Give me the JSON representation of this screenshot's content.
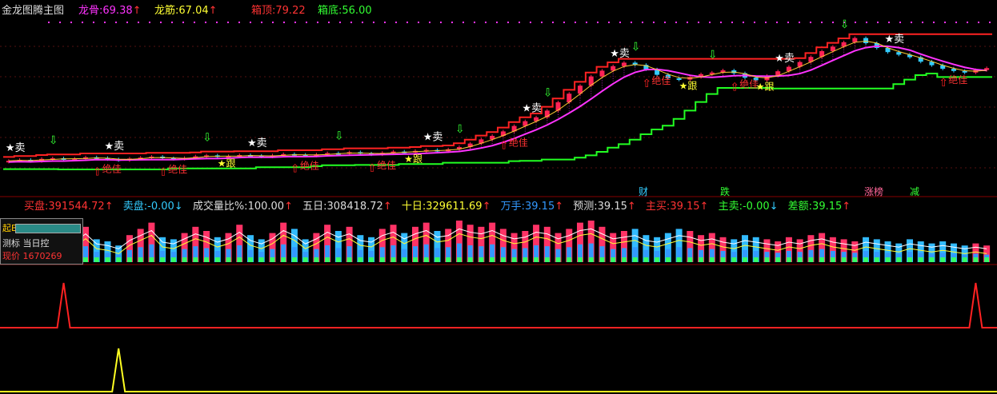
{
  "header": {
    "title": "金龙图腾主图",
    "items": [
      {
        "label": "龙骨:",
        "value": "69.38",
        "arrow": "↑",
        "color": "#ff33ff"
      },
      {
        "label": "龙筋:",
        "value": "67.04",
        "arrow": "↑",
        "color": "#ffff33"
      },
      {
        "label": "箱顶:",
        "value": "79.22",
        "arrow": "",
        "color": "#ff3333"
      },
      {
        "label": "箱底:",
        "value": "56.00",
        "arrow": "",
        "color": "#33ff33"
      }
    ]
  },
  "volume_header": {
    "items": [
      {
        "label": "买盘:",
        "value": "391544.72",
        "arrow": "↑",
        "color": "#ff3333"
      },
      {
        "label": "卖盘:",
        "value": "-0.00",
        "arrow": "↓",
        "color": "#33ccff"
      },
      {
        "label": "成交量比%:",
        "value": "100.00",
        "arrow": "↑",
        "color": "#dddddd"
      },
      {
        "label": "五日:",
        "value": "308418.72",
        "arrow": "↑",
        "color": "#dddddd"
      },
      {
        "label": "十日:",
        "value": "329611.69",
        "arrow": "↑",
        "color": "#ffff33"
      },
      {
        "label": "万手:",
        "value": "39.15",
        "arrow": "↑",
        "color": "#3399ff"
      },
      {
        "label": "预测:",
        "value": "39.15",
        "arrow": "↑",
        "color": "#dddddd"
      },
      {
        "label": "主买:",
        "value": "39.15",
        "arrow": "↑",
        "color": "#ff3333"
      },
      {
        "label": "主卖:",
        "value": "-0.00",
        "arrow": "↓",
        "color": "#33ff33"
      },
      {
        "label": "差额:",
        "value": "39.15",
        "arrow": "↑",
        "color": "#33ff33"
      }
    ]
  },
  "event_labels": [
    {
      "text": "财",
      "color": "#33ccff"
    },
    {
      "text": "跌",
      "color": "#33ff33"
    },
    {
      "text": "涨榜",
      "color": "#ff6699"
    },
    {
      "text": "减",
      "color": "#33ff33"
    }
  ],
  "signal_labels": {
    "sell": "卖",
    "buy": "绝佳",
    "follow": "跟"
  },
  "info_box": {
    "line1": "起B",
    "line2": "测标 当日控",
    "line3": "现价 1670269"
  },
  "chart_data": {
    "type": "candlestick",
    "title": "金龙图腾主图",
    "series": [
      {
        "name": "龙骨",
        "color": "#ff33ff",
        "last": 69.38
      },
      {
        "name": "龙筋",
        "color": "#ffff33",
        "last": 67.04
      },
      {
        "name": "箱顶",
        "color": "#ff3333",
        "last": 79.22
      },
      {
        "name": "箱底",
        "color": "#33ff33",
        "last": 56.0
      }
    ],
    "closes": [
      45.2,
      45.5,
      45.1,
      45.8,
      46.0,
      45.6,
      45.9,
      46.3,
      46.1,
      45.7,
      45.4,
      45.9,
      46.2,
      46.5,
      46.0,
      45.8,
      46.1,
      46.6,
      46.9,
      46.4,
      46.7,
      47.0,
      46.8,
      46.5,
      46.9,
      47.3,
      47.1,
      46.8,
      47.2,
      47.6,
      47.4,
      47.9,
      47.5,
      47.2,
      47.7,
      48.1,
      47.8,
      48.3,
      48.6,
      48.2,
      48.8,
      49.5,
      50.6,
      51.9,
      53.0,
      54.4,
      56.1,
      57.6,
      58.8,
      60.9,
      63.5,
      66.2,
      68.7,
      71.6,
      73.4,
      74.8,
      75.9,
      75.2,
      73.8,
      72.1,
      71.0,
      70.6,
      71.4,
      72.3,
      72.8,
      73.5,
      72.6,
      71.2,
      70.4,
      71.8,
      73.2,
      74.6,
      76.1,
      77.7,
      79.5,
      80.9,
      82.3,
      83.6,
      82.0,
      80.5,
      79.2,
      78.4,
      77.6,
      76.2,
      75.1,
      74.0,
      73.3,
      72.8,
      73.6,
      74.2
    ],
    "volume_ratio": [
      0.45,
      0.62,
      0.55,
      0.9,
      0.7,
      0.5,
      0.6,
      0.85,
      0.55,
      0.5,
      0.4,
      0.65,
      0.8,
      0.95,
      0.6,
      0.55,
      0.7,
      0.85,
      0.75,
      0.6,
      0.7,
      0.9,
      0.65,
      0.55,
      0.7,
      0.95,
      0.8,
      0.55,
      0.7,
      0.9,
      0.75,
      0.85,
      0.65,
      0.6,
      0.8,
      0.9,
      0.7,
      0.85,
      0.95,
      0.75,
      0.8,
      1.0,
      0.9,
      0.85,
      0.95,
      0.8,
      0.7,
      0.75,
      0.9,
      0.85,
      0.7,
      0.8,
      0.95,
      1.0,
      0.85,
      0.7,
      0.75,
      0.8,
      0.65,
      0.6,
      0.7,
      0.8,
      0.75,
      0.65,
      0.7,
      0.6,
      0.55,
      0.65,
      0.6,
      0.55,
      0.5,
      0.6,
      0.55,
      0.65,
      0.7,
      0.6,
      0.55,
      0.5,
      0.6,
      0.55,
      0.5,
      0.45,
      0.55,
      0.5,
      0.45,
      0.5,
      0.45,
      0.4,
      0.45,
      0.4
    ],
    "lower_spikes_red": [
      5,
      88
    ],
    "lower_spikes_yellow": [
      10
    ]
  }
}
